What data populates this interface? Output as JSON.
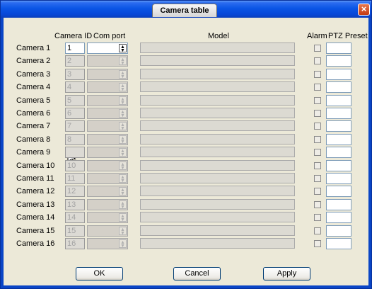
{
  "window": {
    "title": "Camera table",
    "close_glyph": "×"
  },
  "headers": {
    "camera_id": "Camera ID",
    "com_port": "Com port",
    "model": "Model",
    "alarm": "Alarm",
    "ptz_preset": "PTZ Preset"
  },
  "rows": [
    {
      "label": "Camera 1",
      "id": "1"
    },
    {
      "label": "Camera 2",
      "id": "2"
    },
    {
      "label": "Camera 3",
      "id": "3"
    },
    {
      "label": "Camera 4",
      "id": "4"
    },
    {
      "label": "Camera 5",
      "id": "5"
    },
    {
      "label": "Camera 6",
      "id": "6"
    },
    {
      "label": "Camera 7",
      "id": "7"
    },
    {
      "label": "Camera 8",
      "id": "8"
    },
    {
      "label": "Camera 9",
      "id": ""
    },
    {
      "label": "Camera 10",
      "id": "10"
    },
    {
      "label": "Camera 11",
      "id": "11"
    },
    {
      "label": "Camera 12",
      "id": "12"
    },
    {
      "label": "Camera 13",
      "id": "13"
    },
    {
      "label": "Camera 14",
      "id": "14"
    },
    {
      "label": "Camera 15",
      "id": "15"
    },
    {
      "label": "Camera 16",
      "id": "16"
    }
  ],
  "buttons": {
    "ok": "OK",
    "cancel": "Cancel",
    "apply": "Apply"
  },
  "icons": {
    "close": "close-icon",
    "combo_arrow": "updown-arrow-icon",
    "cursor": "mouse-pointer-icon"
  },
  "colors": {
    "titlebar": "#0a55e5",
    "dialog_bg": "#ece9d8",
    "close_button": "#c23a12"
  }
}
